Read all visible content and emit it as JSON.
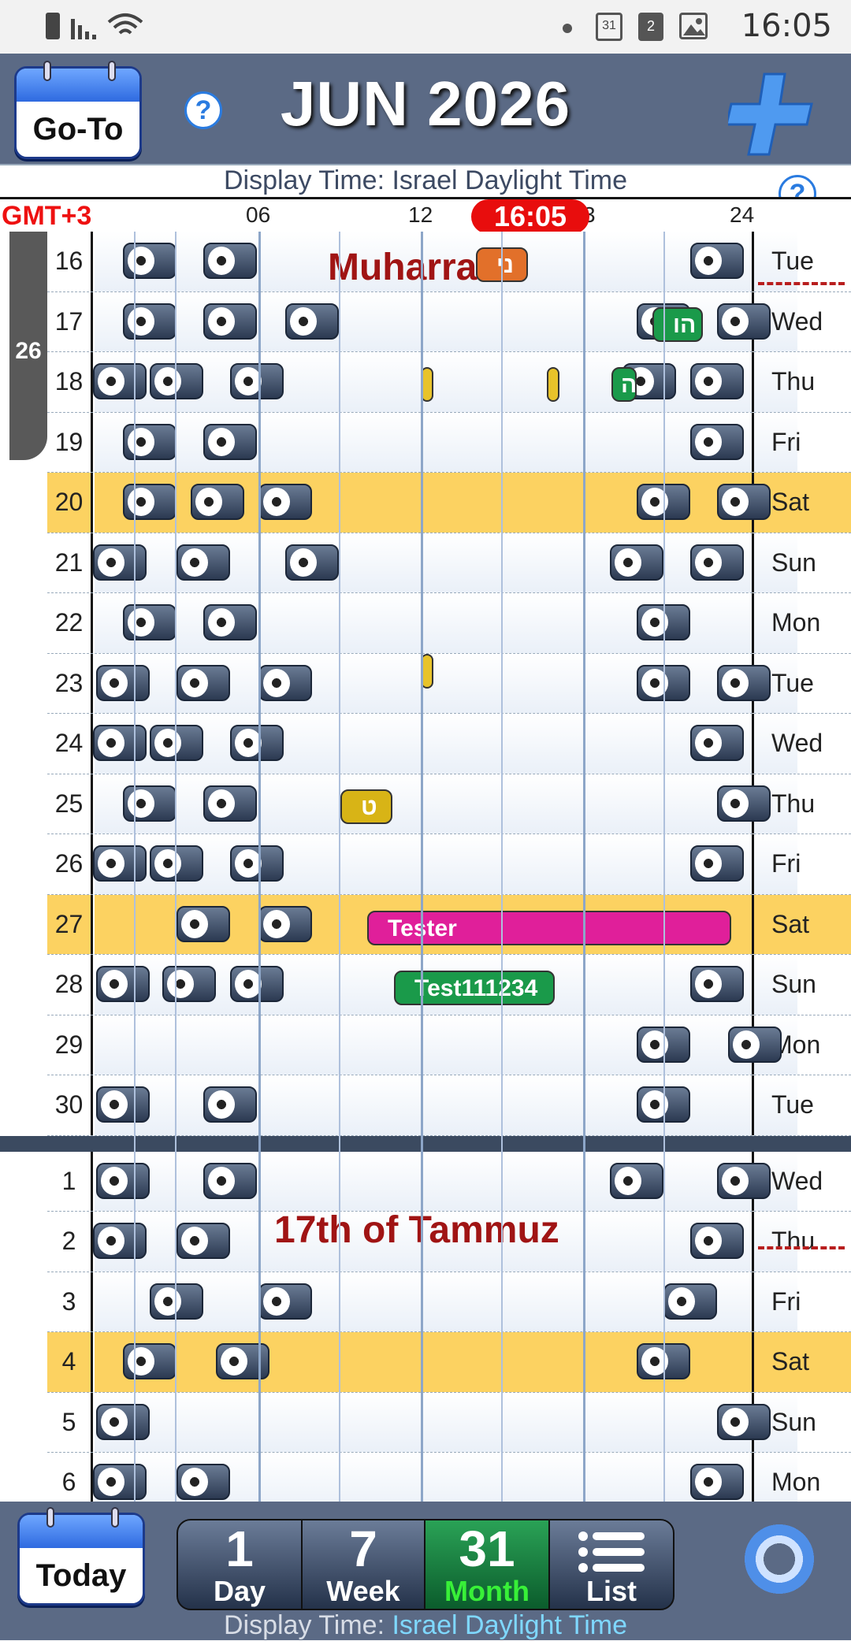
{
  "status_bar": {
    "time": "16:05",
    "icons": [
      "battery-icon",
      "signal-icon",
      "wifi-icon",
      "dot-icon",
      "calendar31-icon",
      "calendar2-icon",
      "image-icon"
    ]
  },
  "header": {
    "goto_label": "Go-To",
    "title": "JUN 2026",
    "help": "?"
  },
  "display_time": {
    "label": "Display Time: Israel Daylight Time",
    "prefix": "Display Time: ",
    "tz": "Israel Daylight Time"
  },
  "ruler": {
    "gmt": "GMT+3",
    "ticks": [
      "06",
      "12",
      "3",
      "24"
    ],
    "now": "16:05"
  },
  "week_number": "26",
  "rows": [
    {
      "d": "16",
      "w": "Tue"
    },
    {
      "d": "17",
      "w": "Wed"
    },
    {
      "d": "18",
      "w": "Thu"
    },
    {
      "d": "19",
      "w": "Fri"
    },
    {
      "d": "20",
      "w": "Sat"
    },
    {
      "d": "21",
      "w": "Sun"
    },
    {
      "d": "22",
      "w": "Mon"
    },
    {
      "d": "23",
      "w": "Tue"
    },
    {
      "d": "24",
      "w": "Wed"
    },
    {
      "d": "25",
      "w": "Thu"
    },
    {
      "d": "26",
      "w": "Fri"
    },
    {
      "d": "27",
      "w": "Sat"
    },
    {
      "d": "28",
      "w": "Sun"
    },
    {
      "d": "29",
      "w": "Mon"
    },
    {
      "d": "30",
      "w": "Tue"
    },
    {
      "d": "1",
      "w": "Wed"
    },
    {
      "d": "2",
      "w": "Thu"
    },
    {
      "d": "3",
      "w": "Fri"
    },
    {
      "d": "4",
      "w": "Sat"
    },
    {
      "d": "5",
      "w": "Sun"
    },
    {
      "d": "6",
      "w": "Mon"
    }
  ],
  "holidays": {
    "muharram": "Muharram",
    "tammuz": "17th of Tammuz"
  },
  "events": {
    "tester": "Tester",
    "test": "Test111234",
    "orange": "ני",
    "green1": "הו",
    "green2": "ה",
    "yellow": "ט"
  },
  "colors": {
    "header": "#5b6a85",
    "saturday": "#fcd261",
    "tester": "#e01f9a",
    "test": "#1a9a4a",
    "now": "#e80d0d"
  },
  "bottom": {
    "today_label": "Today",
    "tabs": [
      {
        "num": "1",
        "label": "Day"
      },
      {
        "num": "7",
        "label": "Week"
      },
      {
        "num": "31",
        "label": "Month"
      },
      {
        "num": "",
        "label": "List"
      }
    ]
  }
}
